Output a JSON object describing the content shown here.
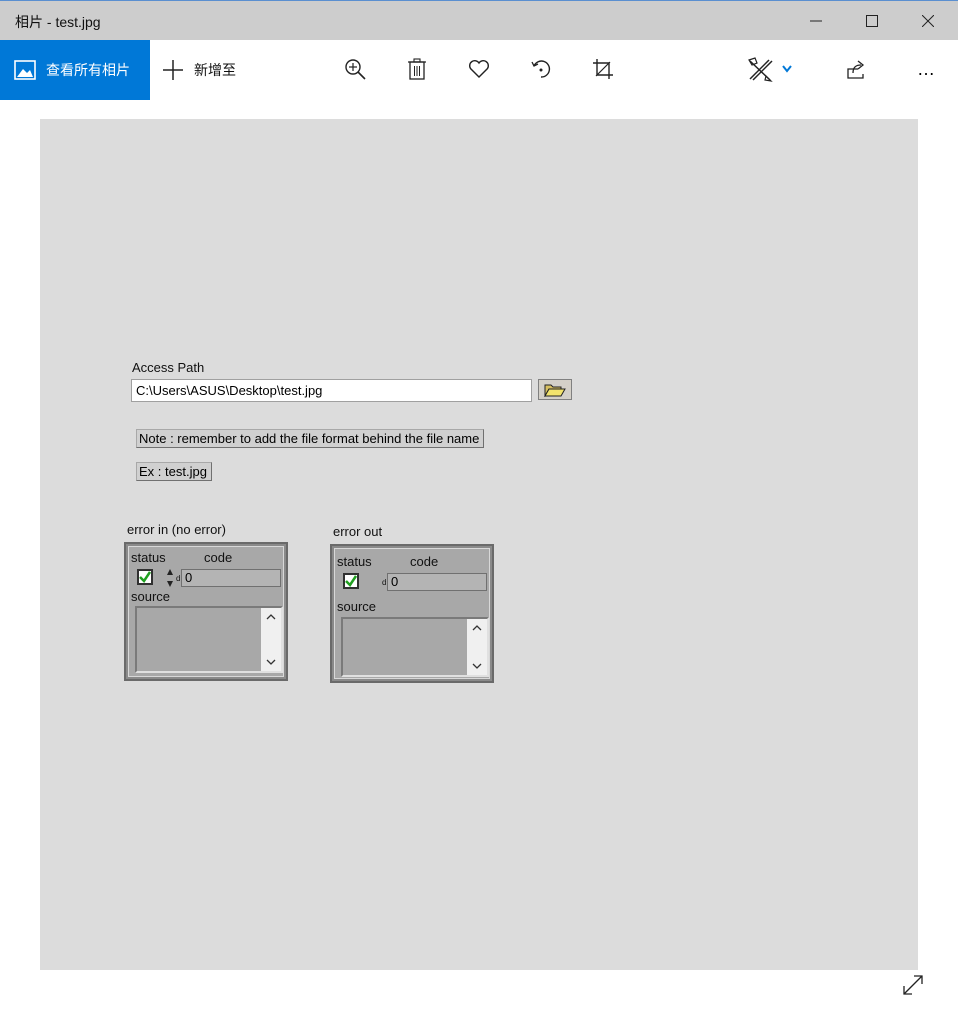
{
  "window": {
    "title": "相片 - test.jpg",
    "controls": [
      "minimize-icon",
      "maximize-icon",
      "close-icon"
    ]
  },
  "toolbar": {
    "view_all_label": "查看所有相片",
    "add_to_label": "新增至",
    "icons": [
      "zoom-in-icon",
      "delete-icon",
      "favorite-icon",
      "rotate-icon",
      "crop-icon",
      "edit-create-icon",
      "share-icon",
      "more-icon"
    ],
    "more_label": "…",
    "accent_color": "#0078d7"
  },
  "image": {
    "access_path_label": "Access Path",
    "access_path_value": "C:\\Users\\ASUS\\Desktop\\test.jpg",
    "note_text": "Note : remember to add the file format behind the file name",
    "example_text": "Ex : test.jpg",
    "error_in": {
      "label": "error in (no error)",
      "status_label": "status",
      "code_label": "code",
      "code_value": "0",
      "source_label": "source",
      "d_tag": "d"
    },
    "error_out": {
      "label": "error out",
      "status_label": "status",
      "code_label": "code",
      "code_value": "0",
      "source_label": "source",
      "d_tag": "d"
    }
  }
}
